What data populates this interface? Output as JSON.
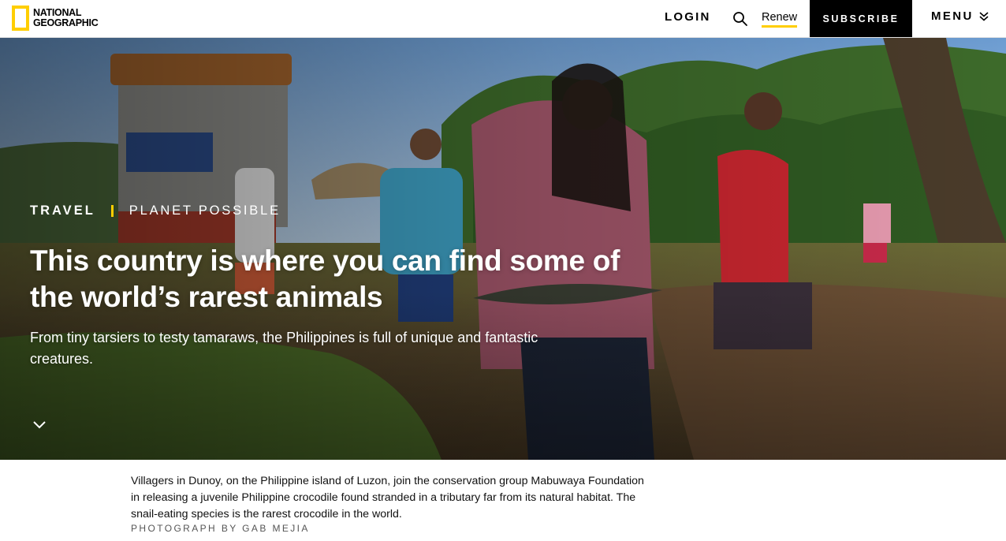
{
  "header": {
    "logo_line1": "NATIONAL",
    "logo_line2": "GEOGRAPHIC",
    "login_label": "LOGIN",
    "search_icon": "search-icon",
    "renew_label": "Renew",
    "subscribe_label": "SUBSCRIBE",
    "menu_label": "MENU",
    "menu_icon": "double-chevron-down-icon"
  },
  "hero": {
    "kicker_primary": "TRAVEL",
    "kicker_secondary": "PLANET POSSIBLE",
    "headline": "This country is where you can find some of the world’s rarest animals",
    "dek": "From tiny tarsiers to testy tamaraws, the Philippines is full of unique and fantastic creatures.",
    "scroll_icon": "chevron-down-icon"
  },
  "caption": {
    "text": "Villagers in Dunoy, on the Philippine island of Luzon, join the conservation group Mabuwaya Foundation in releasing a juvenile Philippine crocodile found stranded in a tributary far from its natural habitat. The snail-eating species is the rarest crocodile in the world.",
    "credit": "PHOTOGRAPH BY GAB MEJIA"
  },
  "colors": {
    "brand_yellow": "#ffce00",
    "header_bg": "#ffffff",
    "subscribe_bg": "#000000"
  }
}
